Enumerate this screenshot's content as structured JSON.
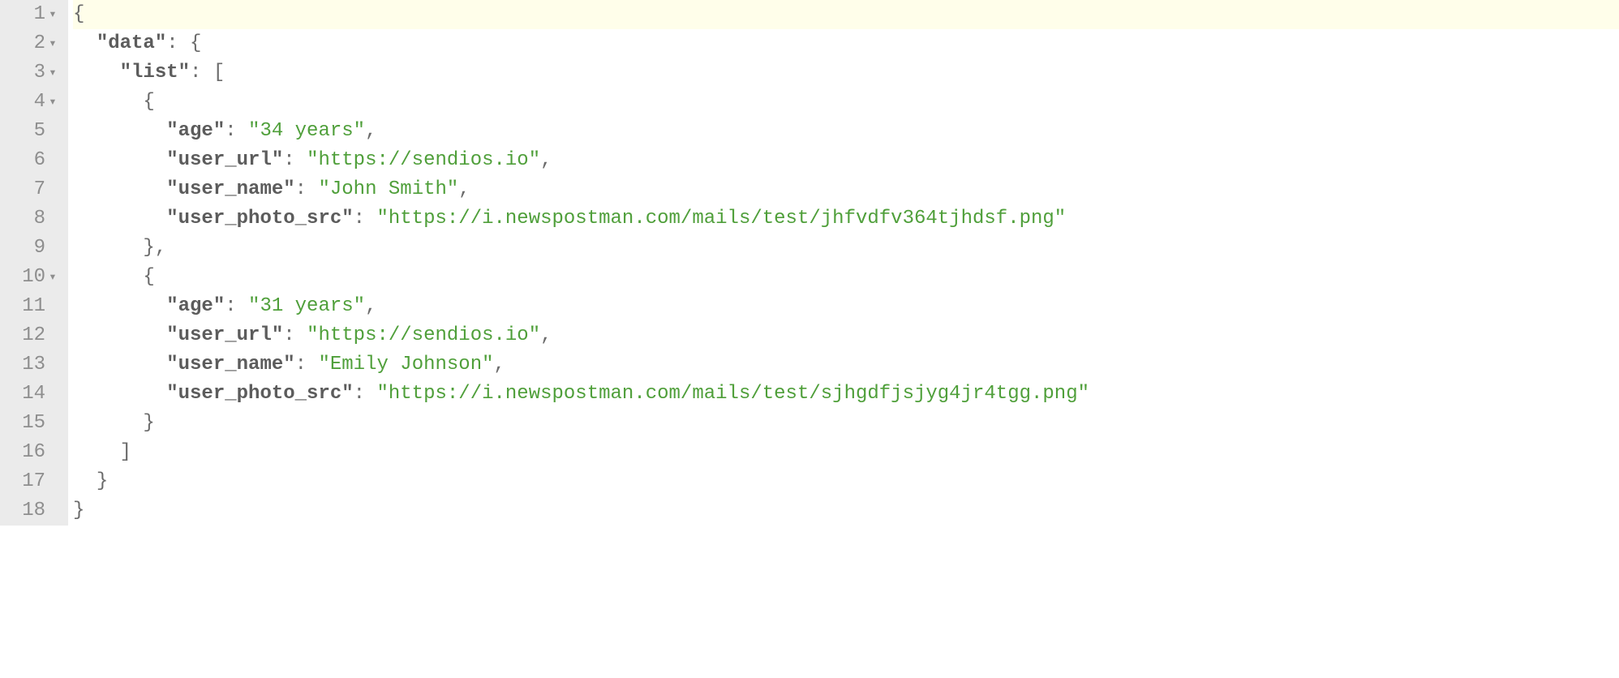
{
  "fold_marker": "▾",
  "gutter": {
    "lines": [
      {
        "n": "1",
        "foldable": true
      },
      {
        "n": "2",
        "foldable": true
      },
      {
        "n": "3",
        "foldable": true
      },
      {
        "n": "4",
        "foldable": true
      },
      {
        "n": "5",
        "foldable": false
      },
      {
        "n": "6",
        "foldable": false
      },
      {
        "n": "7",
        "foldable": false
      },
      {
        "n": "8",
        "foldable": false
      },
      {
        "n": "9",
        "foldable": false
      },
      {
        "n": "10",
        "foldable": true
      },
      {
        "n": "11",
        "foldable": false
      },
      {
        "n": "12",
        "foldable": false
      },
      {
        "n": "13",
        "foldable": false
      },
      {
        "n": "14",
        "foldable": false
      },
      {
        "n": "15",
        "foldable": false
      },
      {
        "n": "16",
        "foldable": false
      },
      {
        "n": "17",
        "foldable": false
      },
      {
        "n": "18",
        "foldable": false
      }
    ]
  },
  "code": {
    "punct": {
      "lbrace": "{",
      "rbrace": "}",
      "lbracket": "[",
      "rbracket": "]",
      "colon": ":",
      "comma": ",",
      "space": " "
    },
    "keys": {
      "data": "\"data\"",
      "list": "\"list\"",
      "age": "\"age\"",
      "user_url": "\"user_url\"",
      "user_name": "\"user_name\"",
      "user_photo_src": "\"user_photo_src\""
    },
    "vals": {
      "age0": "\"34 years\"",
      "url0": "\"https://sendios.io\"",
      "name0": "\"John Smith\"",
      "photo0": "\"https://i.newspostman.com/mails/test/jhfvdfv364tjhdsf.png\"",
      "age1": "\"31 years\"",
      "url1": "\"https://sendios.io\"",
      "name1": "\"Emily Johnson\"",
      "photo1": "\"https://i.newspostman.com/mails/test/sjhgdfjsjyg4jr4tgg.png\""
    }
  }
}
